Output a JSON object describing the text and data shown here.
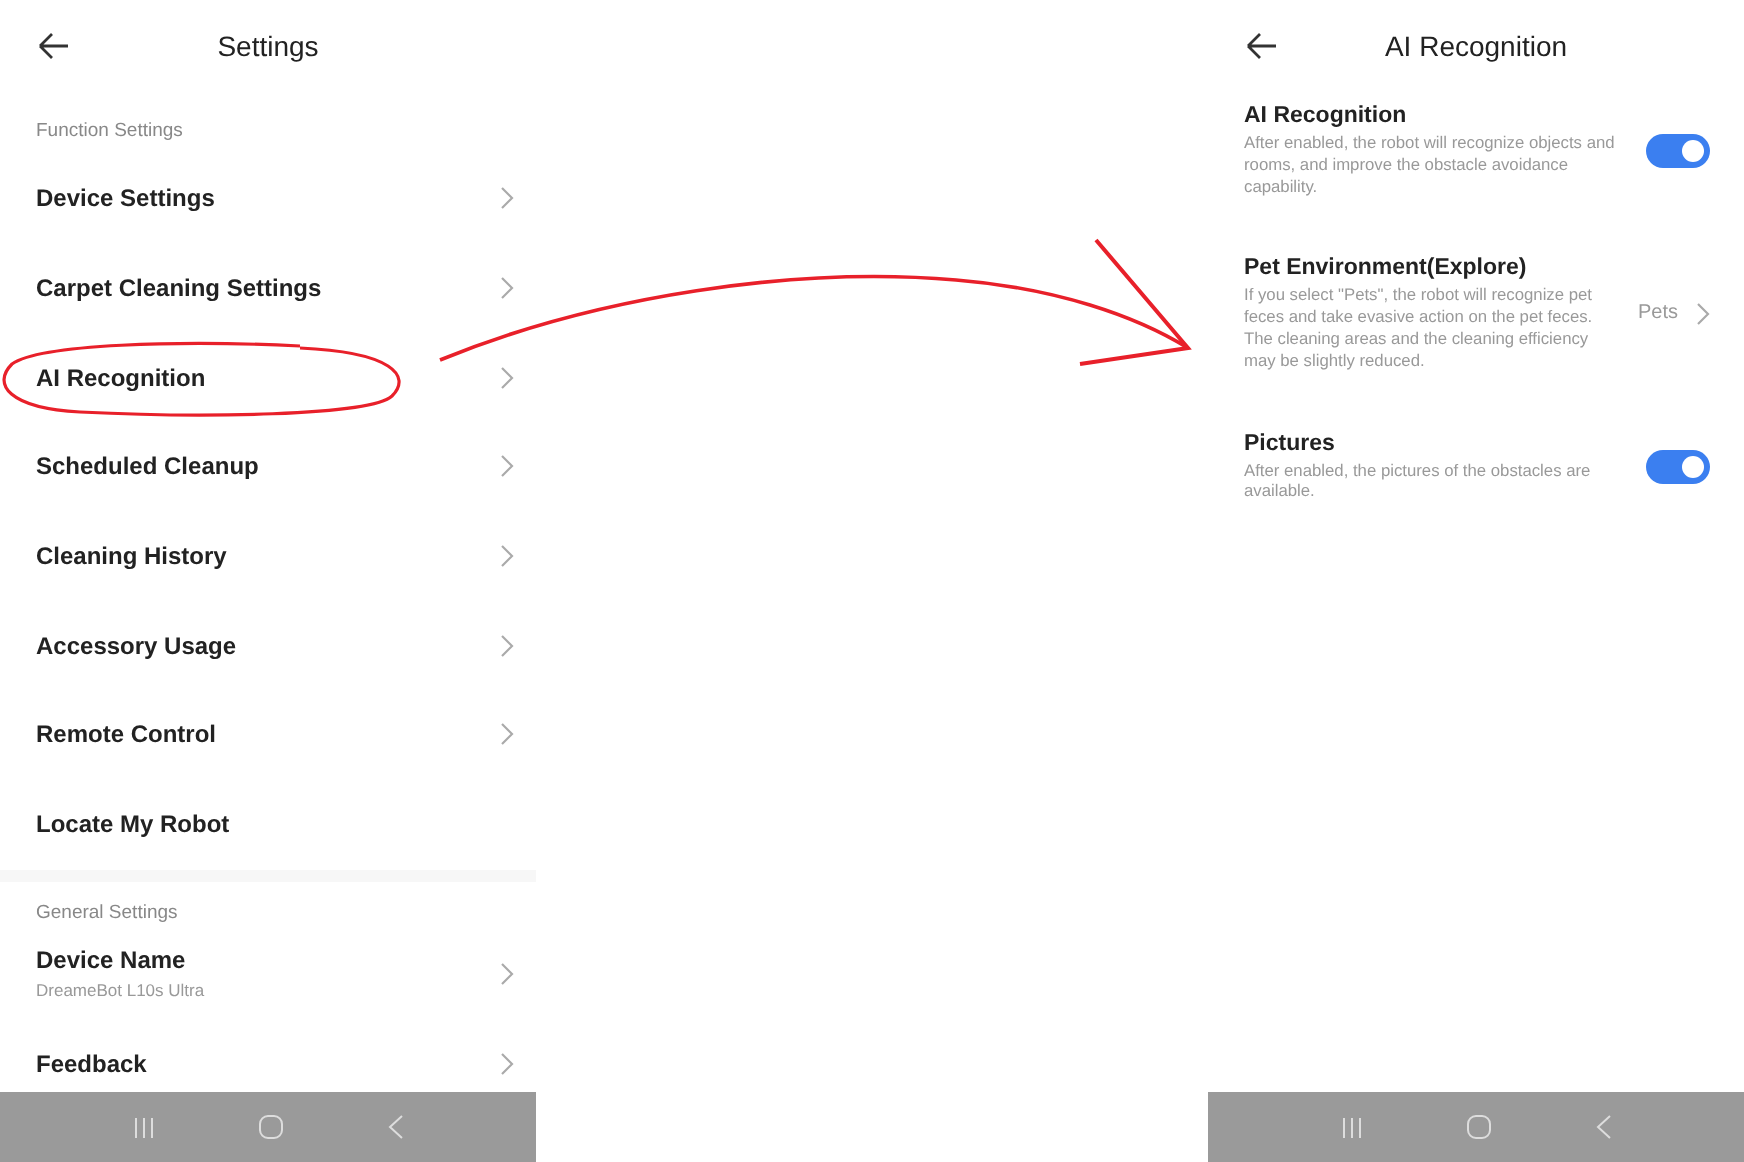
{
  "left_screen": {
    "title": "Settings",
    "sections": [
      {
        "heading": "Function Settings",
        "items": [
          {
            "label": "Device Settings",
            "kind": "link",
            "highlighted": false
          },
          {
            "label": "Carpet Cleaning Settings",
            "kind": "link",
            "highlighted": false
          },
          {
            "label": "AI Recognition",
            "kind": "link",
            "highlighted": true
          },
          {
            "label": "Scheduled Cleanup",
            "kind": "link",
            "highlighted": false
          },
          {
            "label": "Cleaning History",
            "kind": "link",
            "highlighted": false
          },
          {
            "label": "Accessory Usage",
            "kind": "link",
            "highlighted": false
          },
          {
            "label": "Remote Control",
            "kind": "link",
            "highlighted": false
          },
          {
            "label": "Locate My Robot",
            "kind": "action",
            "highlighted": false
          }
        ]
      },
      {
        "heading": "General Settings",
        "items": [
          {
            "label": "Device Name",
            "subtitle": "DreameBot L10s Ultra",
            "kind": "link",
            "highlighted": false
          },
          {
            "label": "Feedback",
            "kind": "link",
            "highlighted": false
          }
        ]
      }
    ]
  },
  "right_screen": {
    "title": "AI Recognition",
    "settings": [
      {
        "kind": "toggle",
        "label": "AI Recognition",
        "description": "After enabled, the robot will recognize objects and rooms, and improve the obstacle avoidance capability.",
        "on": true
      },
      {
        "kind": "select",
        "label": "Pet Environment(Explore)",
        "description": "If you select \"Pets\", the robot will recognize pet feces and take evasive action on the pet feces. The cleaning areas and the cleaning efficiency may be slightly reduced.",
        "value": "Pets"
      },
      {
        "kind": "toggle",
        "label": "Pictures",
        "description": "After enabled, the pictures of the obstacles are available.",
        "on": true
      }
    ]
  }
}
